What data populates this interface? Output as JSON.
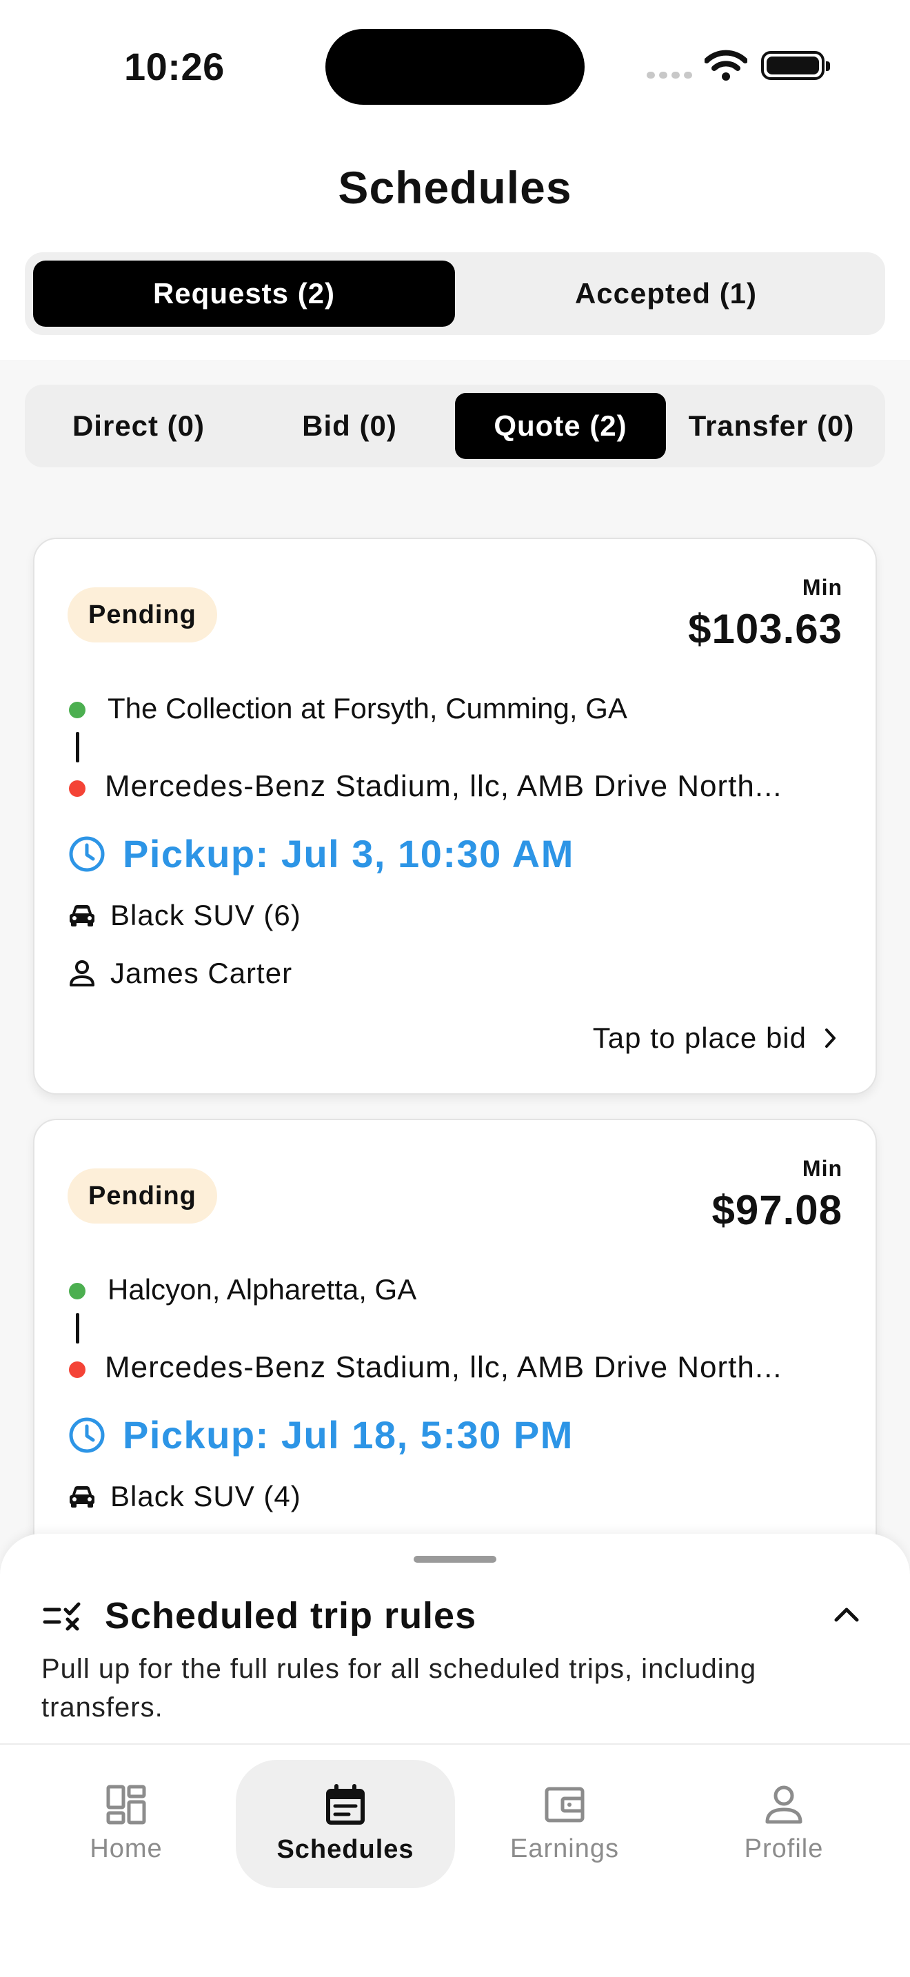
{
  "status_bar": {
    "time": "10:26"
  },
  "header": {
    "title": "Schedules",
    "tabs": [
      {
        "label": "Requests (2)",
        "active": true
      },
      {
        "label": "Accepted (1)",
        "active": false
      }
    ]
  },
  "sub_tabs": [
    {
      "label": "Direct (0)",
      "active": false
    },
    {
      "label": "Bid (0)",
      "active": false
    },
    {
      "label": "Quote (2)",
      "active": true
    },
    {
      "label": "Transfer (0)",
      "active": false
    }
  ],
  "trips": [
    {
      "status": "Pending",
      "min_label": "Min",
      "price": "$103.63",
      "from": "The Collection at Forsyth, Cumming, GA",
      "to": "Mercedes-Benz Stadium, llc, AMB Drive North...",
      "pickup": "Pickup: Jul 3, 10:30 AM",
      "vehicle": "Black SUV (6)",
      "passenger": "James Carter",
      "action": "Tap to place bid"
    },
    {
      "status": "Pending",
      "min_label": "Min",
      "price": "$97.08",
      "from": "Halcyon, Alpharetta, GA",
      "to": "Mercedes-Benz Stadium, llc, AMB Drive North...",
      "pickup": "Pickup: Jul 18, 5:30 PM",
      "vehicle": "Black SUV (4)"
    }
  ],
  "rules_sheet": {
    "title": "Scheduled trip rules",
    "description": "Pull up for the full rules for all scheduled trips, including transfers."
  },
  "nav": [
    {
      "label": "Home",
      "icon": "grid-icon",
      "active": false
    },
    {
      "label": "Schedules",
      "icon": "calendar-icon",
      "active": true
    },
    {
      "label": "Earnings",
      "icon": "wallet-icon",
      "active": false
    },
    {
      "label": "Profile",
      "icon": "person-icon",
      "active": false
    }
  ],
  "colors": {
    "accent_blue": "#2D95E6",
    "pending_badge": "#FDEFD9",
    "origin_dot": "#4CAF50",
    "destination_dot": "#F44336"
  }
}
